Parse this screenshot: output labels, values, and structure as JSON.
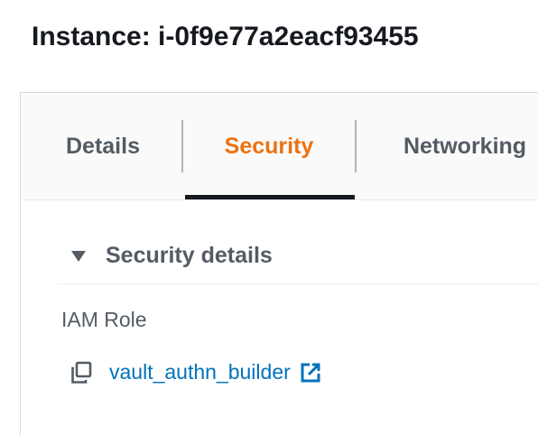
{
  "header": {
    "title": "Instance: i-0f9e77a2eacf93455"
  },
  "tabs": [
    {
      "label": "Details",
      "active": false
    },
    {
      "label": "Security",
      "active": true
    },
    {
      "label": "Networking",
      "active": false
    }
  ],
  "security_details": {
    "section_title": "Security details",
    "expanded": true,
    "iam_role": {
      "label": "IAM Role",
      "value": "vault_authn_builder"
    }
  },
  "icons": {
    "caret": "caret-down-icon",
    "copy": "copy-icon",
    "external_link": "external-link-icon"
  },
  "colors": {
    "active_tab": "#ec7211",
    "link": "#0073bb",
    "text": "#545b64",
    "title": "#16191f"
  }
}
